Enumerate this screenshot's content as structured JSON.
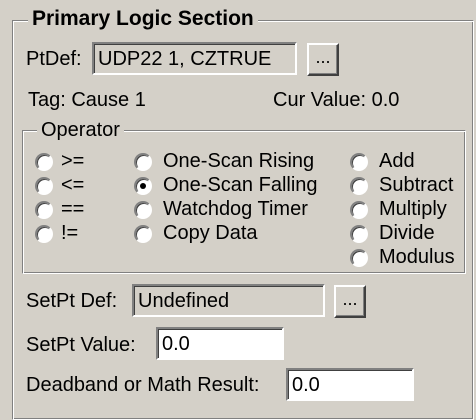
{
  "section_title": "Primary Logic Section",
  "ptdef": {
    "label": "PtDef:",
    "value": "UDP22 1, CZTRUE",
    "browse": "..."
  },
  "tag": "Tag: Cause 1",
  "cur_value": "Cur Value: 0.0",
  "operator": {
    "title": "Operator",
    "col1": [
      {
        "label": ">=",
        "selected": false
      },
      {
        "label": "<=",
        "selected": false
      },
      {
        "label": "==",
        "selected": false
      },
      {
        "label": "!=",
        "selected": false
      }
    ],
    "col2": [
      {
        "label": "One-Scan Rising",
        "selected": false
      },
      {
        "label": "One-Scan Falling",
        "selected": true
      },
      {
        "label": "Watchdog Timer",
        "selected": false
      },
      {
        "label": "Copy Data",
        "selected": false
      }
    ],
    "col3": [
      {
        "label": "Add",
        "selected": false
      },
      {
        "label": "Subtract",
        "selected": false
      },
      {
        "label": "Multiply",
        "selected": false
      },
      {
        "label": "Divide",
        "selected": false
      },
      {
        "label": "Modulus",
        "selected": false
      }
    ]
  },
  "setpt_def": {
    "label": "SetPt Def:",
    "value": "Undefined",
    "browse": "..."
  },
  "setpt_value": {
    "label": "SetPt Value:",
    "value": "0.0"
  },
  "deadband": {
    "label": "Deadband or Math Result:",
    "value": "0.0"
  }
}
